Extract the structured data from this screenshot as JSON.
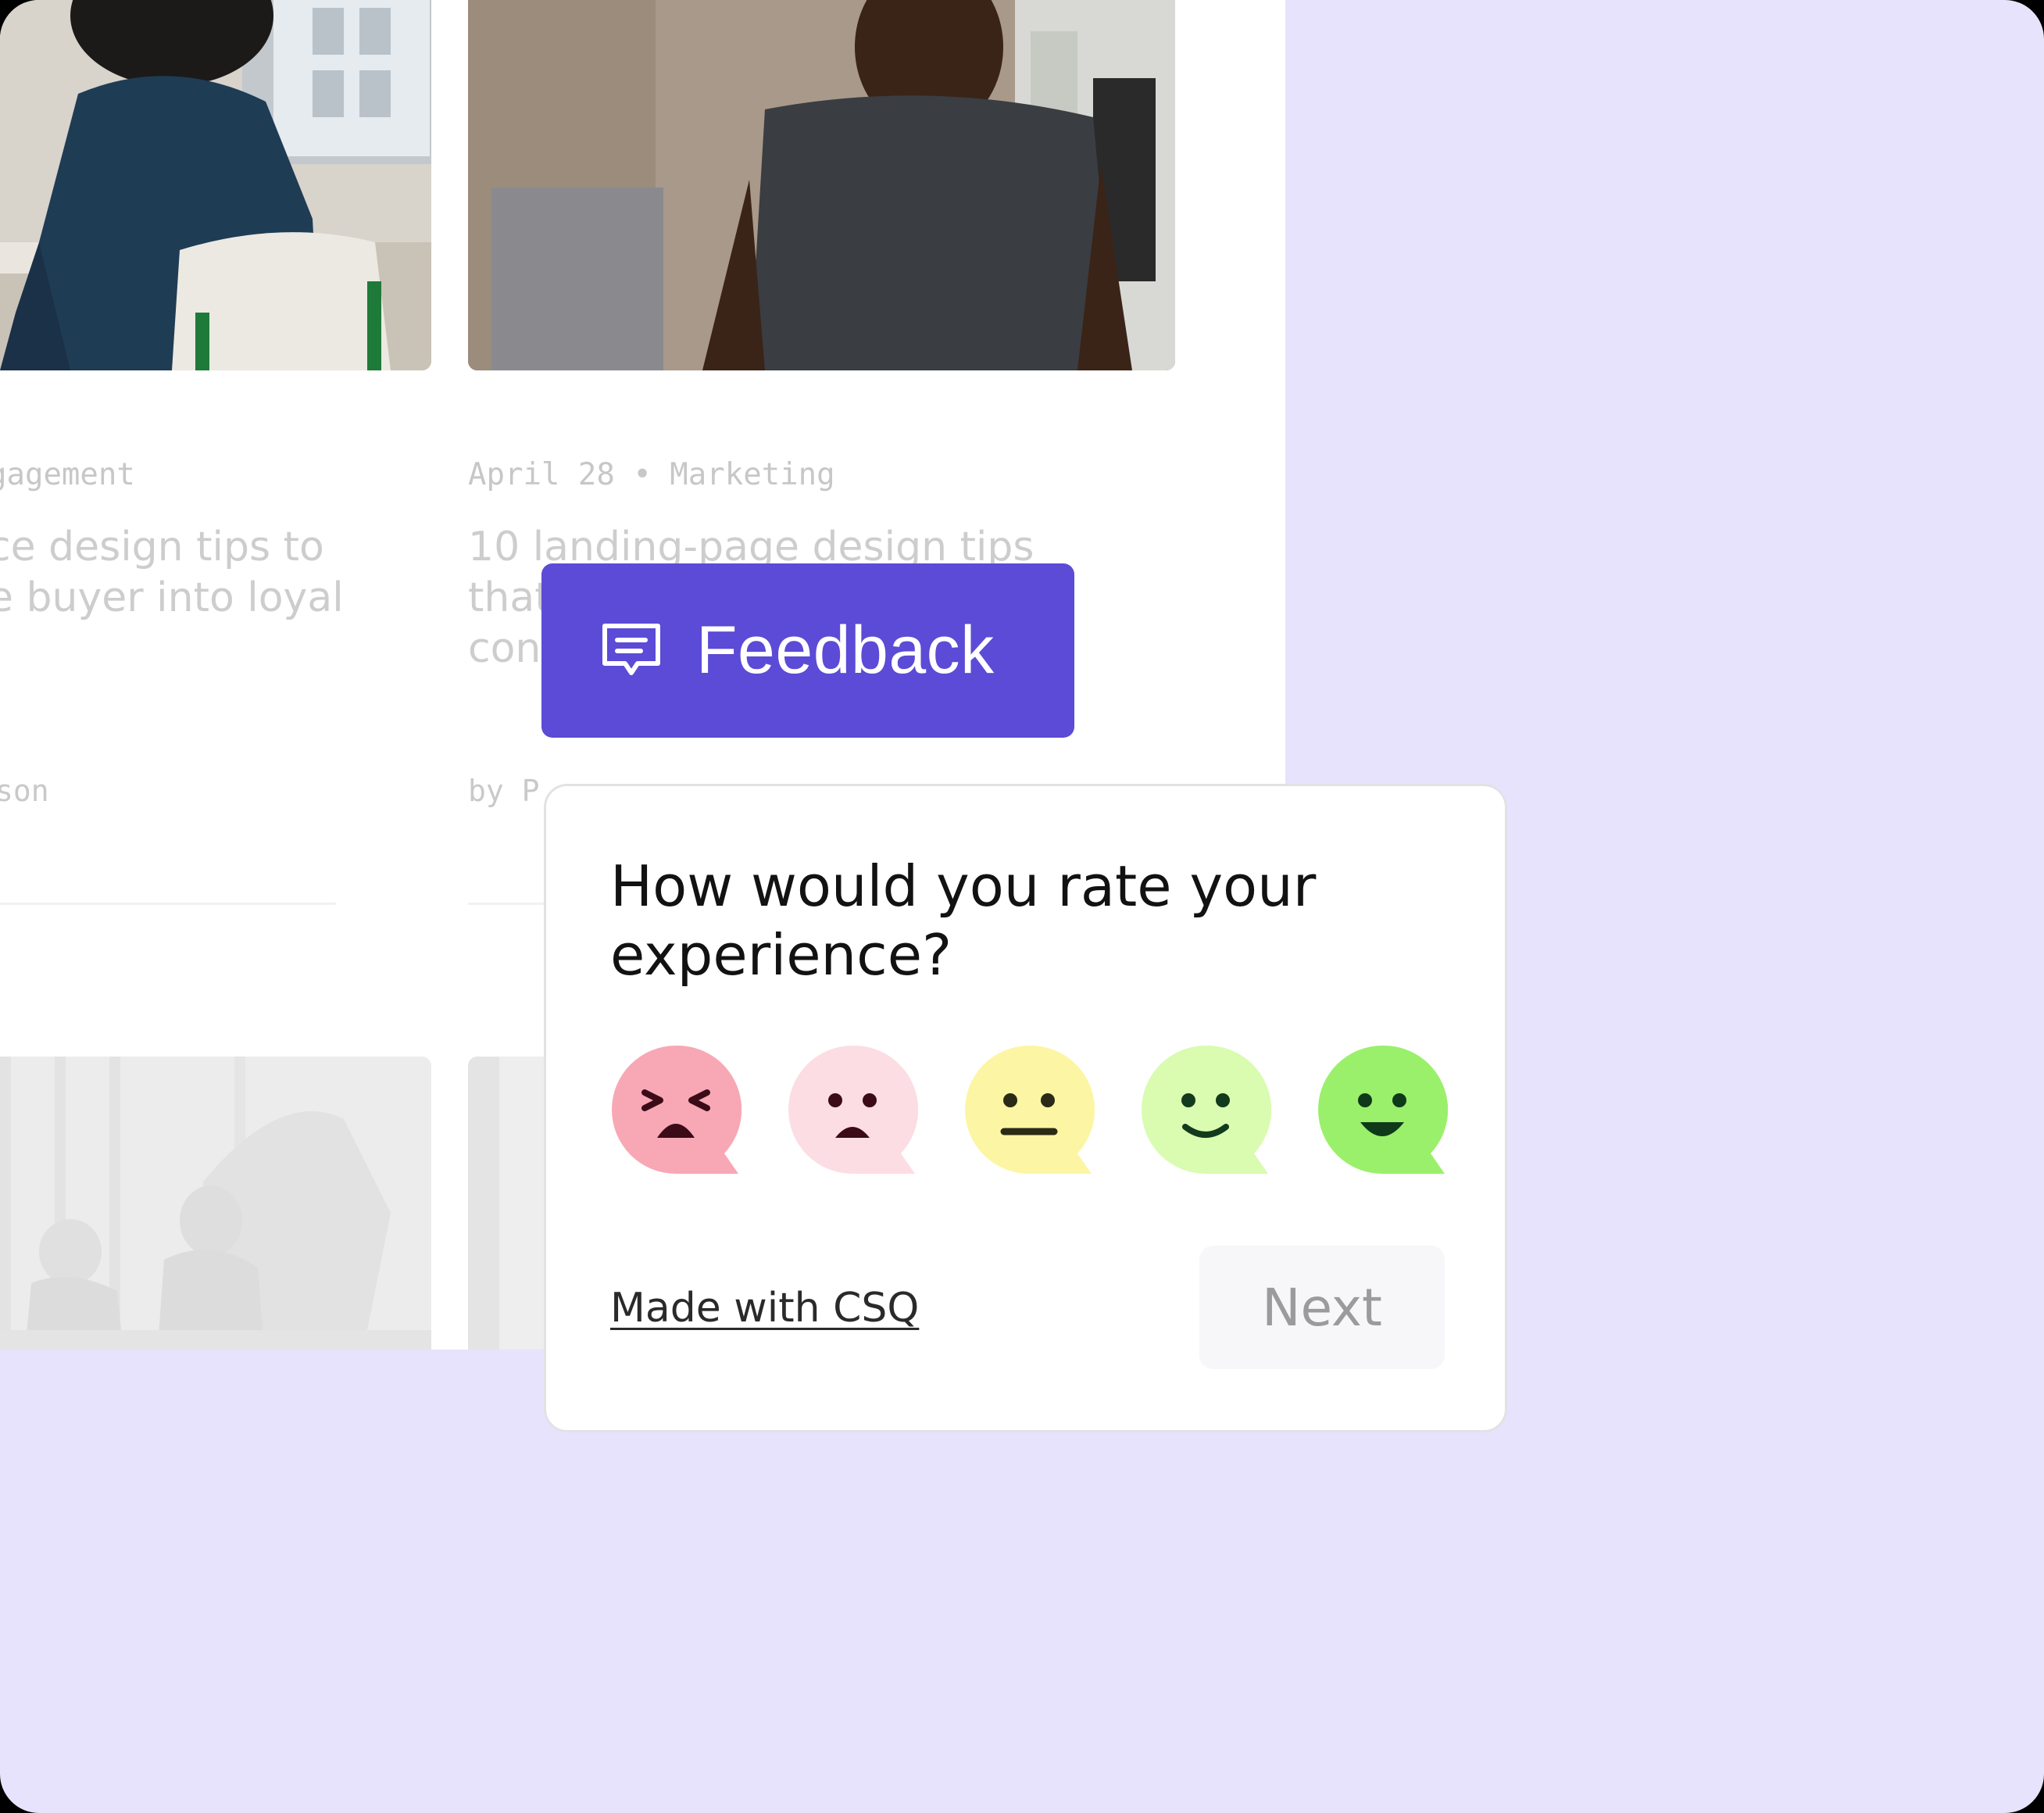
{
  "blog": {
    "cards": [
      {
        "meta": "gagement",
        "title_lines": [
          "ce design tips to",
          "e buyer into loyal"
        ],
        "author": "son"
      },
      {
        "meta": "April 28 • Marketing",
        "title_lines": [
          "10 landing-page design tips",
          "that",
          "con"
        ],
        "author": "by P"
      }
    ]
  },
  "feedback_tab": {
    "label": "Feedback",
    "icon": "chat-bubble-icon",
    "color": "#5B4BD6"
  },
  "survey": {
    "question": "How would you rate your experience?",
    "ratings": [
      {
        "icon": "very-dissatisfied-face-icon",
        "color": "#F7A8B4"
      },
      {
        "icon": "dissatisfied-face-icon",
        "color": "#FCDDE3"
      },
      {
        "icon": "neutral-face-icon",
        "color": "#FCF6A4"
      },
      {
        "icon": "satisfied-face-icon",
        "color": "#D9FCB0"
      },
      {
        "icon": "very-satisfied-face-icon",
        "color": "#9AF06A"
      }
    ],
    "branding_link": "Made with CSQ",
    "next_label": "Next"
  },
  "colors": {
    "background": "#E7E3FC",
    "accent": "#5B4BD6"
  }
}
